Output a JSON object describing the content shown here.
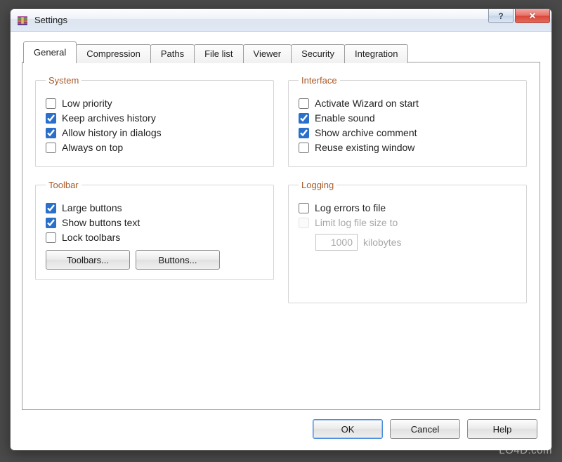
{
  "window": {
    "title": "Settings"
  },
  "tabs": [
    {
      "label": "General",
      "active": true
    },
    {
      "label": "Compression",
      "active": false
    },
    {
      "label": "Paths",
      "active": false
    },
    {
      "label": "File list",
      "active": false
    },
    {
      "label": "Viewer",
      "active": false
    },
    {
      "label": "Security",
      "active": false
    },
    {
      "label": "Integration",
      "active": false
    }
  ],
  "groups": {
    "system": {
      "legend": "System",
      "items": [
        {
          "label": "Low priority",
          "checked": false
        },
        {
          "label": "Keep archives history",
          "checked": true
        },
        {
          "label": "Allow history in dialogs",
          "checked": true
        },
        {
          "label": "Always on top",
          "checked": false
        }
      ]
    },
    "interface": {
      "legend": "Interface",
      "items": [
        {
          "label": "Activate Wizard on start",
          "checked": false
        },
        {
          "label": "Enable sound",
          "checked": true
        },
        {
          "label": "Show archive comment",
          "checked": true
        },
        {
          "label": "Reuse existing window",
          "checked": false
        }
      ]
    },
    "toolbar": {
      "legend": "Toolbar",
      "items": [
        {
          "label": "Large buttons",
          "checked": true
        },
        {
          "label": "Show buttons text",
          "checked": true
        },
        {
          "label": "Lock toolbars",
          "checked": false
        }
      ],
      "buttons": {
        "toolbars": "Toolbars...",
        "buttons_btn": "Buttons..."
      }
    },
    "logging": {
      "legend": "Logging",
      "log_errors": {
        "label": "Log errors to file",
        "checked": false
      },
      "limit": {
        "label": "Limit log file size to",
        "checked": false,
        "disabled": true
      },
      "size_value": "1000",
      "size_unit": "kilobytes"
    }
  },
  "footer": {
    "ok": "OK",
    "cancel": "Cancel",
    "help": "Help"
  },
  "titlebar_icons": {
    "help": "?",
    "close": "✕"
  },
  "watermark": "LO4D.com"
}
